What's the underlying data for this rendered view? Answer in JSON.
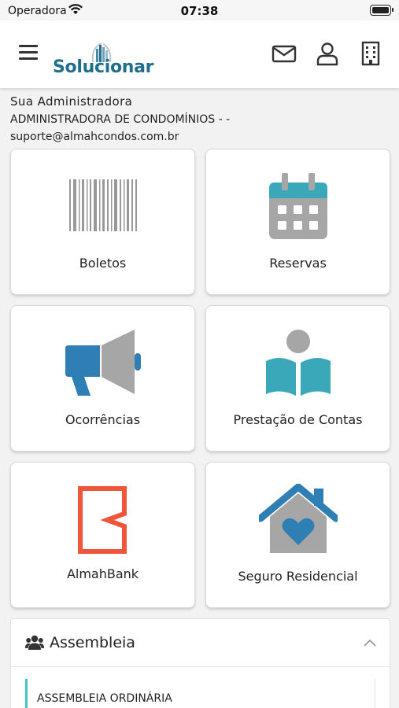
{
  "status_bar": {
    "carrier": "Operadora",
    "time": "07:38"
  },
  "header": {
    "logo_text": "Solucionar",
    "icons": [
      "menu-icon",
      "mail-icon",
      "user-icon",
      "building-icon"
    ],
    "brand_color": "#1f6e8c"
  },
  "admin": {
    "title": "Sua Administradora",
    "name": "ADMINISTRADORA DE CONDOMÍNIOS - -",
    "email": "suporte@almahcondos.com.br"
  },
  "tiles": [
    {
      "label": "Boletos",
      "icon": "barcode-icon"
    },
    {
      "label": "Reservas",
      "icon": "calendar-icon"
    },
    {
      "label": "Ocorrências",
      "icon": "megaphone-icon"
    },
    {
      "label": "Prestação de Contas",
      "icon": "reader-book-icon"
    },
    {
      "label": "AlmahBank",
      "icon": "almahbank-logo-icon"
    },
    {
      "label": "Seguro Residencial",
      "icon": "house-heart-icon"
    }
  ],
  "assembleia": {
    "title": "Assembleia",
    "items": [
      {
        "label": "ASSEMBLEIA ORDINÁRIA"
      }
    ],
    "accent": "#3fc6c6"
  },
  "colors": {
    "teal": "#3aa8b8",
    "blue": "#2f7fb5",
    "gray": "#a6a6a6",
    "almahbank_red": "#f0553a"
  }
}
